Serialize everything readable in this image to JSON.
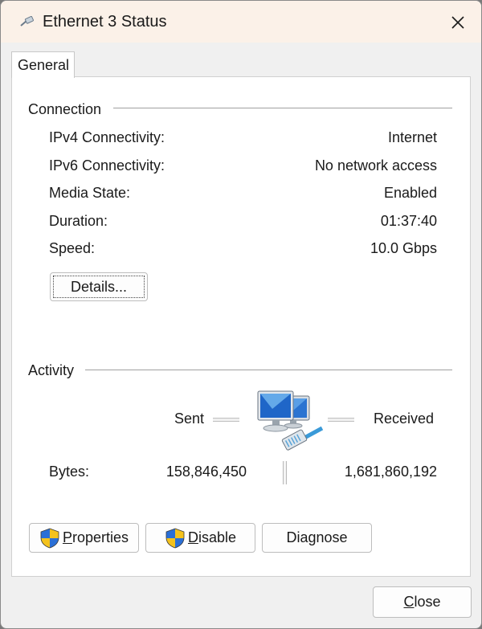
{
  "window": {
    "title": "Ethernet 3 Status"
  },
  "tabs": [
    {
      "label": "General"
    }
  ],
  "connection": {
    "title": "Connection",
    "rows": [
      {
        "label": "IPv4 Connectivity:",
        "value": "Internet"
      },
      {
        "label": "IPv6 Connectivity:",
        "value": "No network access"
      },
      {
        "label": "Media State:",
        "value": "Enabled"
      },
      {
        "label": "Duration:",
        "value": "01:37:40"
      },
      {
        "label": "Speed:",
        "value": "10.0 Gbps"
      }
    ],
    "details_button": "Details..."
  },
  "activity": {
    "title": "Activity",
    "sent_label": "Sent",
    "received_label": "Received",
    "bytes_label": "Bytes:",
    "bytes_sent": "158,846,450",
    "bytes_received": "1,681,860,192"
  },
  "buttons": {
    "properties_first": "P",
    "properties_rest": "roperties",
    "disable_first": "D",
    "disable_rest": "isable",
    "diagnose": "Diagnose",
    "close_first": "C",
    "close_rest": "lose"
  },
  "icons": {
    "title": "ethernet-cable-icon",
    "close": "close-icon",
    "network": "network-computers-icon",
    "shield": "uac-shield-icon"
  },
  "colors": {
    "titlebar_bg": "#fbf1e8",
    "window_bg": "#f0f0f0",
    "panel_bg": "#ffffff",
    "shield_blue": "#2a6fd6",
    "shield_yellow": "#f4c21c"
  }
}
